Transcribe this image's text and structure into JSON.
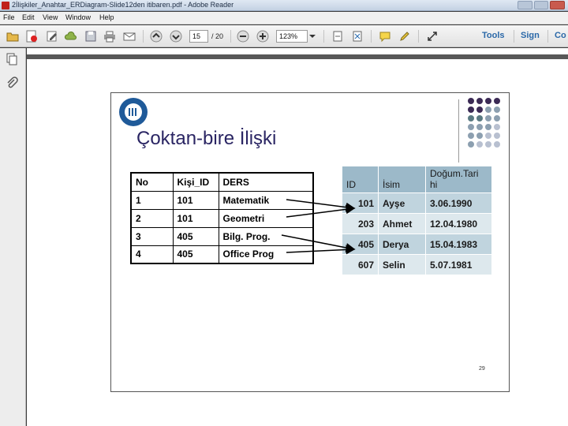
{
  "window": {
    "title": "2İlişkiler_Anahtar_ERDiagram-Slide12den itibaren.pdf - Adobe Reader"
  },
  "menu": [
    "File",
    "Edit",
    "View",
    "Window",
    "Help"
  ],
  "toolbar": {
    "page_current": "15",
    "page_total": "/ 20",
    "zoom": "123%",
    "tools_label": "Tools",
    "sign_label": "Sign",
    "comment_label": "Co"
  },
  "slide": {
    "title": "Çoktan-bire İlişki",
    "page_number": "29",
    "left_table": {
      "headers": [
        "No",
        "Kişi_ID",
        "DERS"
      ],
      "rows": [
        [
          "1",
          "101",
          "Matematik"
        ],
        [
          "2",
          "101",
          "Geometri"
        ],
        [
          "3",
          "405",
          "Bilg. Prog."
        ],
        [
          "4",
          "405",
          "Office Prog"
        ]
      ]
    },
    "right_table": {
      "headers": [
        "ID",
        "İsim",
        "Doğum.Tari hi"
      ],
      "rows": [
        [
          "101",
          "Ayşe",
          "3.06.1990"
        ],
        [
          "203",
          "Ahmet",
          "12.04.1980"
        ],
        [
          "405",
          "Derya",
          "15.04.1983"
        ],
        [
          "607",
          "Selin",
          "5.07.1981"
        ]
      ]
    },
    "dot_colors": [
      "#3b2a55",
      "#6b4a80",
      "#7c6a9a",
      "#9aa7b8"
    ]
  }
}
